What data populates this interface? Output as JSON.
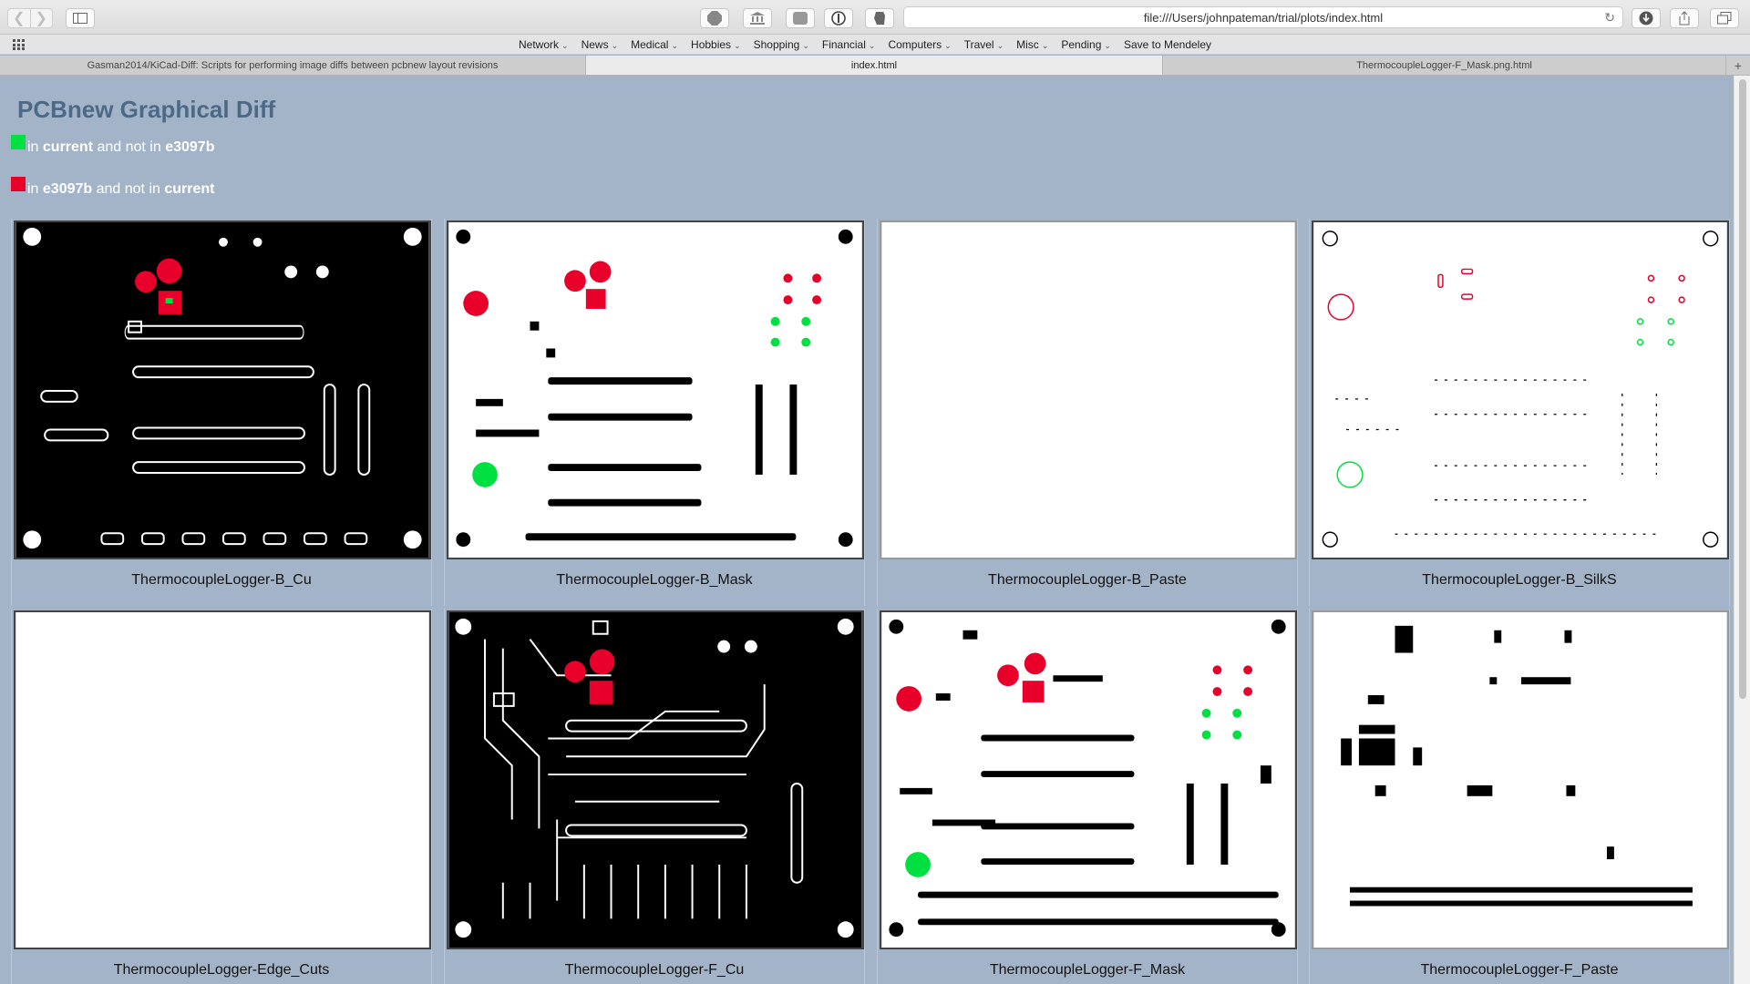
{
  "browser": {
    "url": "file:///Users/johnpateman/trial/plots/index.html",
    "bookmarks": [
      "Network",
      "News",
      "Medical",
      "Hobbies",
      "Shopping",
      "Financial",
      "Computers",
      "Travel",
      "Misc",
      "Pending",
      "Save to Mendeley"
    ],
    "tabs": [
      "Gasman2014/KiCad-Diff: Scripts for performing image diffs between pcbnew layout revisions",
      "index.html",
      "ThermocoupleLogger-F_Mask.png.html"
    ],
    "active_tab": 1
  },
  "page": {
    "title": "PCBnew Graphical Diff",
    "legend": [
      {
        "color": "#00e040",
        "pre": "in ",
        "a": "current",
        "mid": " and not in ",
        "b": "e3097b"
      },
      {
        "color": "#e8002a",
        "pre": "in ",
        "a": "e3097b",
        "mid": " and not in ",
        "b": "current"
      }
    ],
    "colors": {
      "added": "#00e040",
      "removed": "#e8002a",
      "page_bg": "#a4b4c8"
    },
    "layers": [
      "ThermocoupleLogger-B_Cu",
      "ThermocoupleLogger-B_Mask",
      "ThermocoupleLogger-B_Paste",
      "ThermocoupleLogger-B_SilkS",
      "ThermocoupleLogger-Edge_Cuts",
      "ThermocoupleLogger-F_Cu",
      "ThermocoupleLogger-F_Mask",
      "ThermocoupleLogger-F_Paste"
    ]
  }
}
